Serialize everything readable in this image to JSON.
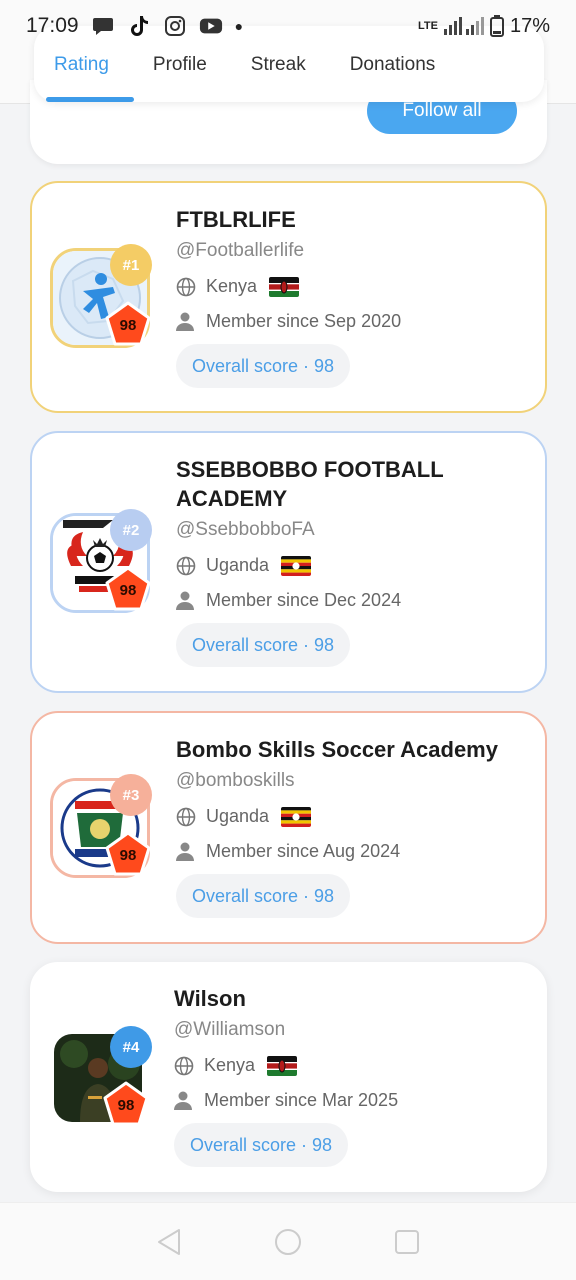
{
  "status_bar": {
    "time": "17:09",
    "network": "LTE",
    "battery": "17%"
  },
  "tabs": [
    {
      "label": "Rating",
      "active": true
    },
    {
      "label": "Profile",
      "active": false
    },
    {
      "label": "Streak",
      "active": false
    },
    {
      "label": "Donations",
      "active": false
    }
  ],
  "top_card": {
    "follow_all_label": "Follow all"
  },
  "players": [
    {
      "rank": "#1",
      "name": "FTBLRLIFE",
      "handle": "@Footballerlife",
      "country": "Kenya",
      "member_since": "Member since Sep 2020",
      "score_badge": "98",
      "overall": "Overall score · 98",
      "theme": "gold"
    },
    {
      "rank": "#2",
      "name": "SSEBBOBBO FOOTBALL ACADEMY",
      "handle": "@SsebbobboFA",
      "country": "Uganda",
      "member_since": "Member since Dec 2024",
      "score_badge": "98",
      "overall": "Overall score · 98",
      "theme": "blue"
    },
    {
      "rank": "#3",
      "name": "Bombo Skills Soccer Academy",
      "handle": "@bomboskills",
      "country": "Uganda",
      "member_since": "Member since Aug 2024",
      "score_badge": "98",
      "overall": "Overall score · 98",
      "theme": "peach"
    },
    {
      "rank": "#4",
      "name": "Wilson",
      "handle": "@Williamson",
      "country": "Kenya",
      "member_since": "Member since Mar 2025",
      "score_badge": "98",
      "overall": "Overall score · 98",
      "theme": "plain"
    }
  ],
  "colors": {
    "accent": "#3d9be9",
    "gold": "#f1d279",
    "blue": "#bcd3f3",
    "peach": "#f4b7a4",
    "score_badge": "#ff4a1c"
  }
}
